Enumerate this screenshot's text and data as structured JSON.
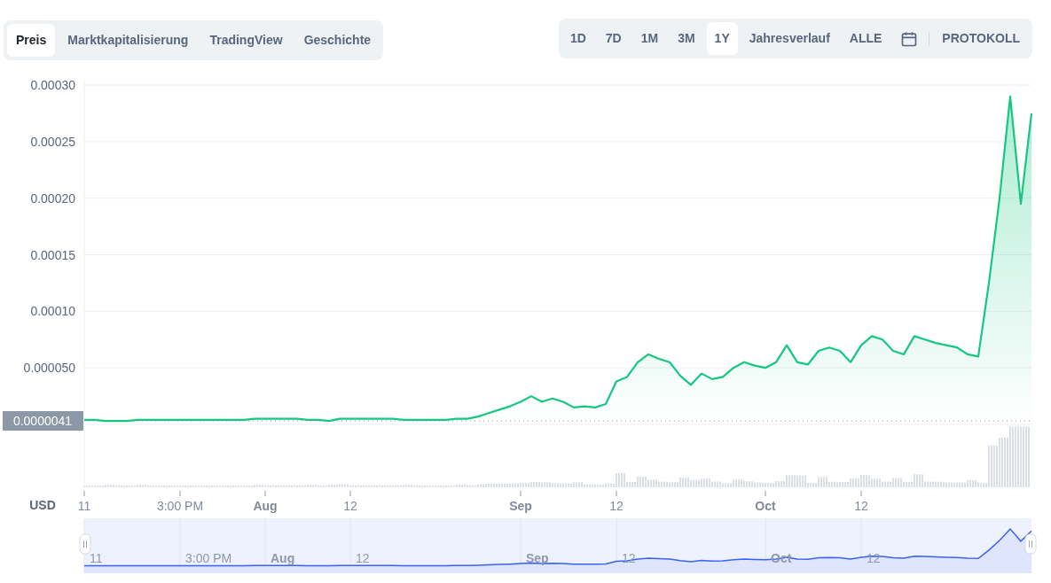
{
  "chart_tabs": [
    {
      "label": "Preis",
      "selected": true
    },
    {
      "label": "Marktkapitalisierung",
      "selected": false
    },
    {
      "label": "TradingView",
      "selected": false
    },
    {
      "label": "Geschichte",
      "selected": false
    }
  ],
  "range_buttons": [
    {
      "label": "1D",
      "selected": false
    },
    {
      "label": "7D",
      "selected": false
    },
    {
      "label": "1M",
      "selected": false
    },
    {
      "label": "3M",
      "selected": false
    },
    {
      "label": "1Y",
      "selected": true
    },
    {
      "label": "Jahresverlauf",
      "selected": false
    },
    {
      "label": "ALLE",
      "selected": false
    }
  ],
  "log_button": "PROTOKOLL",
  "price_chart": {
    "currency": "USD",
    "price_label": "0.0000041",
    "chart_data": {
      "type": "area",
      "grid": true,
      "categories": [
        "11",
        null,
        null,
        null,
        null,
        null,
        null,
        null,
        null,
        "3:00 PM",
        null,
        null,
        null,
        null,
        null,
        null,
        null,
        "Aug",
        null,
        null,
        null,
        null,
        null,
        null,
        null,
        "12",
        null,
        null,
        null,
        null,
        null,
        null,
        null,
        null,
        null,
        null,
        null,
        null,
        null,
        null,
        null,
        "Sep",
        null,
        null,
        null,
        null,
        null,
        null,
        null,
        null,
        "12",
        null,
        null,
        null,
        null,
        null,
        null,
        null,
        null,
        null,
        null,
        null,
        null,
        null,
        "Oct",
        null,
        null,
        null,
        null,
        null,
        null,
        null,
        null,
        "12",
        null,
        null,
        null,
        null,
        null,
        null,
        null,
        null,
        null,
        null,
        null,
        null,
        null,
        null,
        null,
        null
      ],
      "series": [
        {
          "color": "#16c784",
          "values": [
            4e-06,
            4e-06,
            3e-06,
            3e-06,
            3e-06,
            4e-06,
            4e-06,
            4e-06,
            4e-06,
            4e-06,
            4e-06,
            4e-06,
            4e-06,
            4e-06,
            4e-06,
            4e-06,
            5e-06,
            5e-06,
            5e-06,
            5e-06,
            5e-06,
            4e-06,
            4e-06,
            3e-06,
            5e-06,
            5e-06,
            5e-06,
            5e-06,
            5e-06,
            5e-06,
            4e-06,
            4e-06,
            4e-06,
            4e-06,
            4e-06,
            5e-06,
            5e-06,
            7e-06,
            1e-05,
            1.3e-05,
            1.6e-05,
            2e-05,
            2.5e-05,
            2e-05,
            2.3e-05,
            2e-05,
            1.5e-05,
            1.6e-05,
            1.5e-05,
            1.8e-05,
            3.8e-05,
            4.2e-05,
            5.5e-05,
            6.2e-05,
            5.8e-05,
            5.5e-05,
            4.3e-05,
            3.5e-05,
            4.5e-05,
            4e-05,
            4.2e-05,
            5e-05,
            5.5e-05,
            5.2e-05,
            5e-05,
            5.5e-05,
            7e-05,
            5.5e-05,
            5.3e-05,
            6.5e-05,
            6.8e-05,
            6.5e-05,
            5.5e-05,
            7e-05,
            7.8e-05,
            7.5e-05,
            6.5e-05,
            6.2e-05,
            7.8e-05,
            7.5e-05,
            7.2e-05,
            7e-05,
            6.8e-05,
            6.2e-05,
            6e-05,
            0.000125,
            0.0002,
            0.00029,
            0.000195,
            0.000275
          ]
        }
      ],
      "ylim": [
        -5.56e-05,
        0.0003
      ],
      "yticks": [
        {
          "value": 5e-05,
          "label": "0.000050"
        },
        {
          "value": 0.0001,
          "label": "0.00010"
        },
        {
          "value": 0.00015,
          "label": "0.00015"
        },
        {
          "value": 0.0002,
          "label": "0.00020"
        },
        {
          "value": 0.00025,
          "label": "0.00025"
        },
        {
          "value": 0.0003,
          "label": "0.00030"
        }
      ]
    }
  },
  "navigator": {
    "labels": [
      {
        "label": "11",
        "major": false
      },
      {
        "label": "3:00 PM",
        "major": false
      },
      {
        "label": "Aug",
        "major": true
      },
      {
        "label": "12",
        "major": false
      },
      {
        "label": "Sep",
        "major": true
      },
      {
        "label": "12",
        "major": false
      },
      {
        "label": "Oct",
        "major": true
      },
      {
        "label": "12",
        "major": false
      }
    ]
  }
}
